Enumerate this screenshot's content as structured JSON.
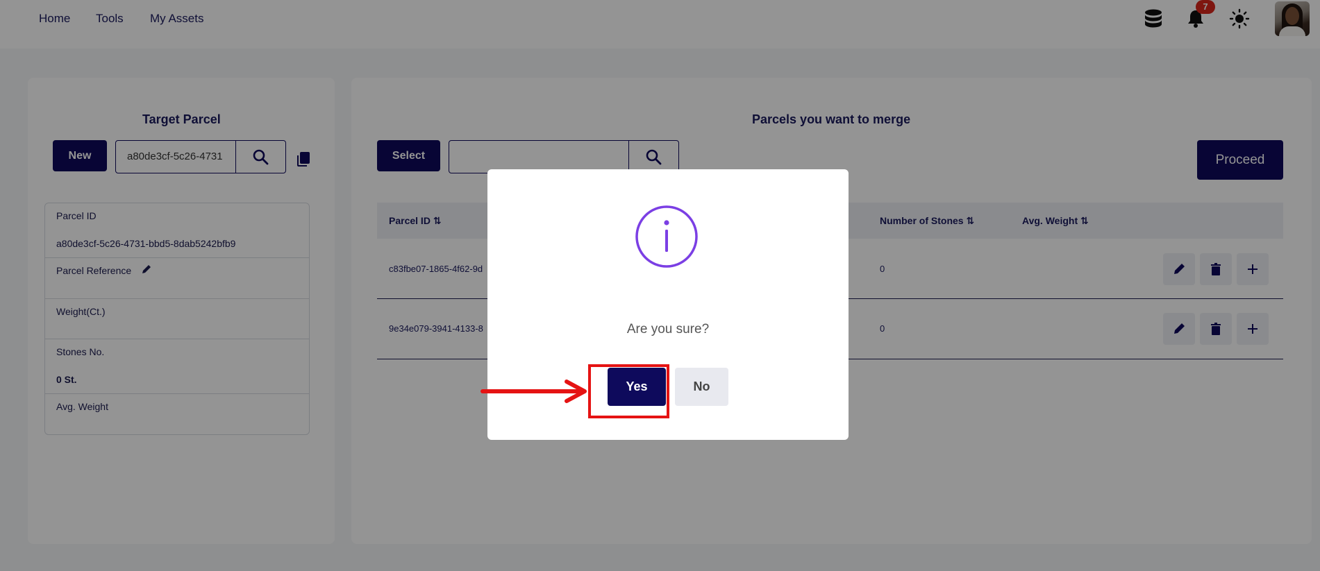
{
  "nav": {
    "home": "Home",
    "tools": "Tools",
    "assets": "My Assets",
    "notification_count": "7",
    "icons": [
      "database-icon",
      "bell-icon",
      "sun-icon"
    ]
  },
  "target": {
    "title": "Target Parcel",
    "new_label": "New",
    "search_value": "a80de3cf-5c26-4731",
    "fields": {
      "parcel_id_label": "Parcel ID",
      "parcel_id_value": "a80de3cf-5c26-4731-bbd5-8dab5242bfb9",
      "reference_label": "Parcel Reference",
      "weight_label": "Weight(Ct.)",
      "stones_label": "Stones No.",
      "stones_value": "0 St.",
      "avg_weight_label": "Avg. Weight"
    }
  },
  "merge": {
    "title": "Parcels you want to merge",
    "select_label": "Select",
    "search_value": "",
    "proceed_label": "Proceed",
    "columns": {
      "parcel_id": "Parcel ID",
      "stones": "Number of Stones",
      "avg_weight": "Avg. Weight"
    },
    "rows": [
      {
        "parcel_id": "c83fbe07-1865-4f62-9d",
        "stones": "0"
      },
      {
        "parcel_id": "9e34e079-3941-4133-8",
        "stones": "0"
      }
    ]
  },
  "modal": {
    "message": "Are you sure?",
    "yes_label": "Yes",
    "no_label": "No"
  },
  "colors": {
    "primary": "#0e0a5c",
    "badge": "#d9261c",
    "highlight": "#e51313",
    "info_icon": "#7b3fe4"
  }
}
